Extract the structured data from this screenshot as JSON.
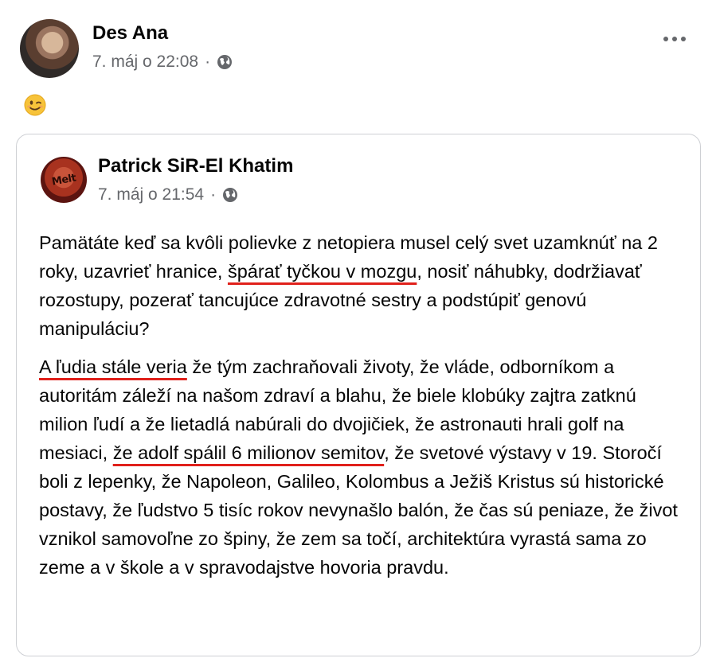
{
  "post": {
    "author": "Des Ana",
    "timestamp": "7. máj o 22:08",
    "separator": "·",
    "privacy_icon": "globe-icon",
    "more_icon": "more-horizontal-icon",
    "emoji": "winking-face"
  },
  "shared": {
    "author": "Patrick SiR-El Khatim",
    "avatar_text": "Melt",
    "timestamp": "7. máj o 21:54",
    "separator": "·",
    "paragraph1": {
      "p1a": "Pamätáte keď sa kvôli polievke z netopiera musel celý svet uzamknúť na 2 roky, uzavrieť hranice, ",
      "p1u": "špárať tyčkou v mozgu",
      "p1b": ", nosiť náhubky, dodržiavať rozostupy, pozerať tancujúce zdravotné sestry a podstúpiť genovú manipuláciu?"
    },
    "paragraph2": {
      "p2u1": "A ľudia stále veria",
      "p2a": " že tým zachraňovali životy, že vláde, odborníkom a autoritám záleží na našom zdraví a blahu, že biele klobúky zajtra zatknú milion ľudí  a že lietadlá nabúrali do dvojičiek, že astronauti hrali golf na mesiaci, ",
      "p2u2": "že adolf spálil 6 milionov semitov",
      "p2b": ", že svetové výstavy v 19. Storočí boli z lepenky, že Napoleon, Galileo, Kolombus a Ježiš Kristus sú historické postavy, že ľudstvo 5 tisíc rokov nevynašlo balón, že čas sú peniaze, že život vznikol samovoľne zo špiny, že zem sa točí, architektúra vyrastá sama zo zeme  a v škole a v spravodajstve hovoria pravdu."
    }
  },
  "colors": {
    "secondary_text": "#65676b",
    "underline": "#e0201b",
    "card_border": "#ced0d4"
  }
}
